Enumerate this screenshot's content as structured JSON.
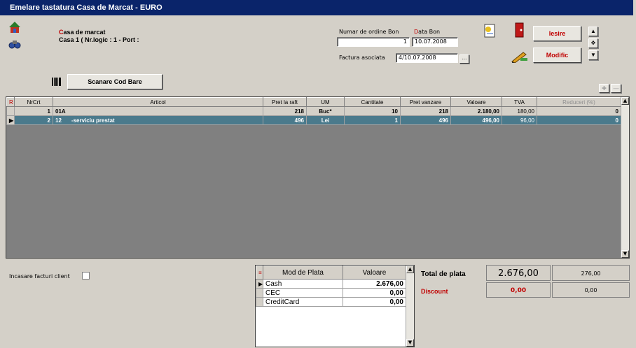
{
  "window": {
    "title": "Emelare tastatura Casa de Marcat - EURO"
  },
  "header": {
    "casa_label_prefix": "C",
    "casa_label_rest": "asa de marcat",
    "casa_detail": "Casa 1 ( Nr.logic : 1 - Port :",
    "numar_ordine_label": "Numar de ordine Bon",
    "numar_ordine_value": "1",
    "data_bon_label_prefix": "D",
    "data_bon_label_rest": "ata Bon",
    "data_bon_value": "10.07.2008",
    "factura_label": "Factura asociata",
    "factura_value": "4/10.07.2008",
    "factura_button": "...",
    "iesire_label": "Iesire",
    "modific_label": "Modific"
  },
  "toolbar": {
    "scan_label": "Scanare Cod Bare"
  },
  "grid": {
    "columns": [
      "R",
      "NrCrt",
      "Articol",
      "Pret la raft",
      "UM",
      "Cantitate",
      "Pret vanzare",
      "Valoare",
      "TVA",
      "Reduceri (%)"
    ],
    "rows": [
      {
        "marker": "",
        "nr": "1",
        "cod": "01A",
        "articol": "",
        "pret_raft": "218",
        "um": "Buc*",
        "cantitate": "10",
        "pret_vanzare": "218",
        "valoare": "2.180,00",
        "tva": "180,00",
        "reduceri": "0"
      },
      {
        "marker": "▶",
        "nr": "2",
        "cod": "12",
        "articol": "-serviciu prestat",
        "pret_raft": "496",
        "um": "Lei",
        "cantitate": "1",
        "pret_vanzare": "496",
        "valoare": "496,00",
        "tva": "96,00",
        "reduceri": "0"
      }
    ]
  },
  "bottom": {
    "incasare_label": "Incasare facturi client",
    "plata_columns": [
      "Mod de Plata",
      "Valoare"
    ],
    "plata_rows": [
      {
        "marker": "▶",
        "mod": "Cash",
        "valoare": "2.676,00"
      },
      {
        "marker": "",
        "mod": "CEC",
        "valoare": "0,00"
      },
      {
        "marker": "",
        "mod": "CreditCard",
        "valoare": "0,00"
      }
    ],
    "total_label": "Total de plata",
    "total_value": "2.676,00",
    "total_tva": "276,00",
    "discount_label": "Discount",
    "discount_value": "0,00",
    "discount_tva": "0,00"
  },
  "colors": {
    "title_bg": "#0a246a",
    "selected_row": "#4a7a8c",
    "red_label": "#c00000"
  }
}
